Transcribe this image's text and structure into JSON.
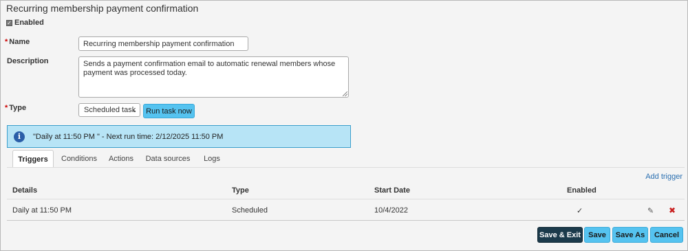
{
  "title": "Recurring membership payment confirmation",
  "enabled": {
    "label": "Enabled",
    "checked": true
  },
  "form": {
    "name_label": "Name",
    "name_value": "Recurring membership payment confirmation",
    "description_label": "Description",
    "description_value": "Sends a payment confirmation email to automatic renewal members whose payment was processed today.",
    "type_label": "Type",
    "type_value": "Scheduled task",
    "required_mark": "*",
    "run_task_label": "Run task now"
  },
  "info": {
    "icon": "info-icon",
    "icon_glyph": "i",
    "text": "\"Daily at 11:50 PM \" - Next run time: 2/12/2025 11:50 PM"
  },
  "tabs": [
    {
      "label": "Triggers",
      "active": true
    },
    {
      "label": "Conditions",
      "active": false
    },
    {
      "label": "Actions",
      "active": false
    },
    {
      "label": "Data sources",
      "active": false
    },
    {
      "label": "Logs",
      "active": false
    }
  ],
  "add_trigger": "Add trigger",
  "table": {
    "columns": [
      "Details",
      "Type",
      "Start Date",
      "Enabled"
    ],
    "rows": [
      {
        "details": "Daily at 11:50 PM",
        "type": "Scheduled",
        "start_date": "10/4/2022",
        "enabled": "✓"
      }
    ]
  },
  "buttons": {
    "save_exit": "Save & Exit",
    "save": "Save",
    "save_as": "Save As",
    "cancel": "Cancel"
  },
  "colors": {
    "accent_button": "#55c3f0",
    "primary_button": "#1b3a4b",
    "info_background": "#b7e4f6",
    "delete_icon": "#c91f1f"
  }
}
